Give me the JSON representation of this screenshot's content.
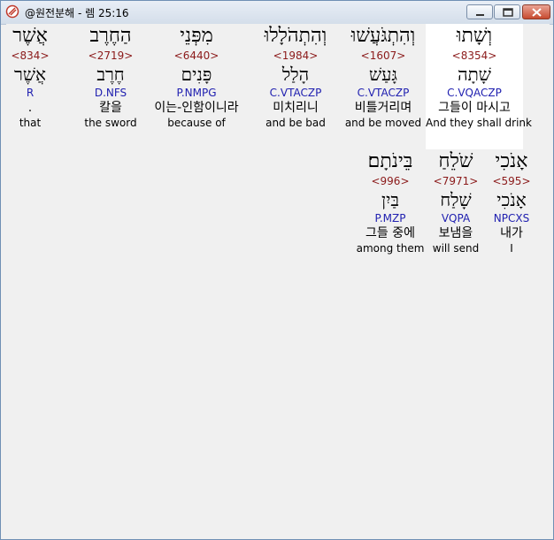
{
  "window": {
    "title": "@원전분해 - 렘 25:16",
    "colors": {
      "strong": "#8b1a1a",
      "morph": "#2020b0",
      "close_button": "#c74a2f"
    }
  },
  "words": [
    {
      "heb": "וְשָׁתוּ",
      "strong": "<8354>",
      "lemma": "שָׁתָה",
      "morph": "C.VQACZP",
      "kor": "그들이 마시고",
      "eng": "And they shall drink"
    },
    {
      "heb": "וְהִתְגֹּעֲשׁוּ",
      "strong": "<1607>",
      "lemma": "גָּעַשׁ",
      "morph": "C.VTACZP",
      "kor": "비틀거리며",
      "eng": "and be moved"
    },
    {
      "heb": "וְהִתְהֹלָלוּ",
      "strong": "<1984>",
      "lemma": "הָלַל",
      "morph": "C.VTACZP",
      "kor": "미치리니",
      "eng": "and be bad"
    },
    {
      "heb": "מִפְּנֵי",
      "strong": "<6440>",
      "lemma": "פָּנִים",
      "morph": "P.NMPG",
      "kor": "이는-인함이니라",
      "eng": "because of"
    },
    {
      "heb": "הַחֶרֶב",
      "strong": "<2719>",
      "lemma": "חֶרֶב",
      "morph": "D.NFS",
      "kor": "칼을",
      "eng": "the sword"
    },
    {
      "heb": "אֲשֶׁר",
      "strong": "<834>",
      "lemma": "אֲשֶׁר",
      "morph": "R",
      "kor": ".",
      "eng": "that"
    },
    {
      "heb": "אָנֹכִי",
      "strong": "<595>",
      "lemma": "אָנֹכִי",
      "morph": "NPCXS",
      "kor": "내가",
      "eng": "I"
    },
    {
      "heb": "שֹׁלֵחַ",
      "strong": "<7971>",
      "lemma": "שָׁלַח",
      "morph": "VQPA",
      "kor": "보냄을",
      "eng": "will send"
    },
    {
      "heb": "בֵּינֹתָם׃",
      "strong": "<996>",
      "lemma": "בַּיִן",
      "morph": "P.MZP",
      "kor": "그들 중에",
      "eng": "among them"
    }
  ]
}
